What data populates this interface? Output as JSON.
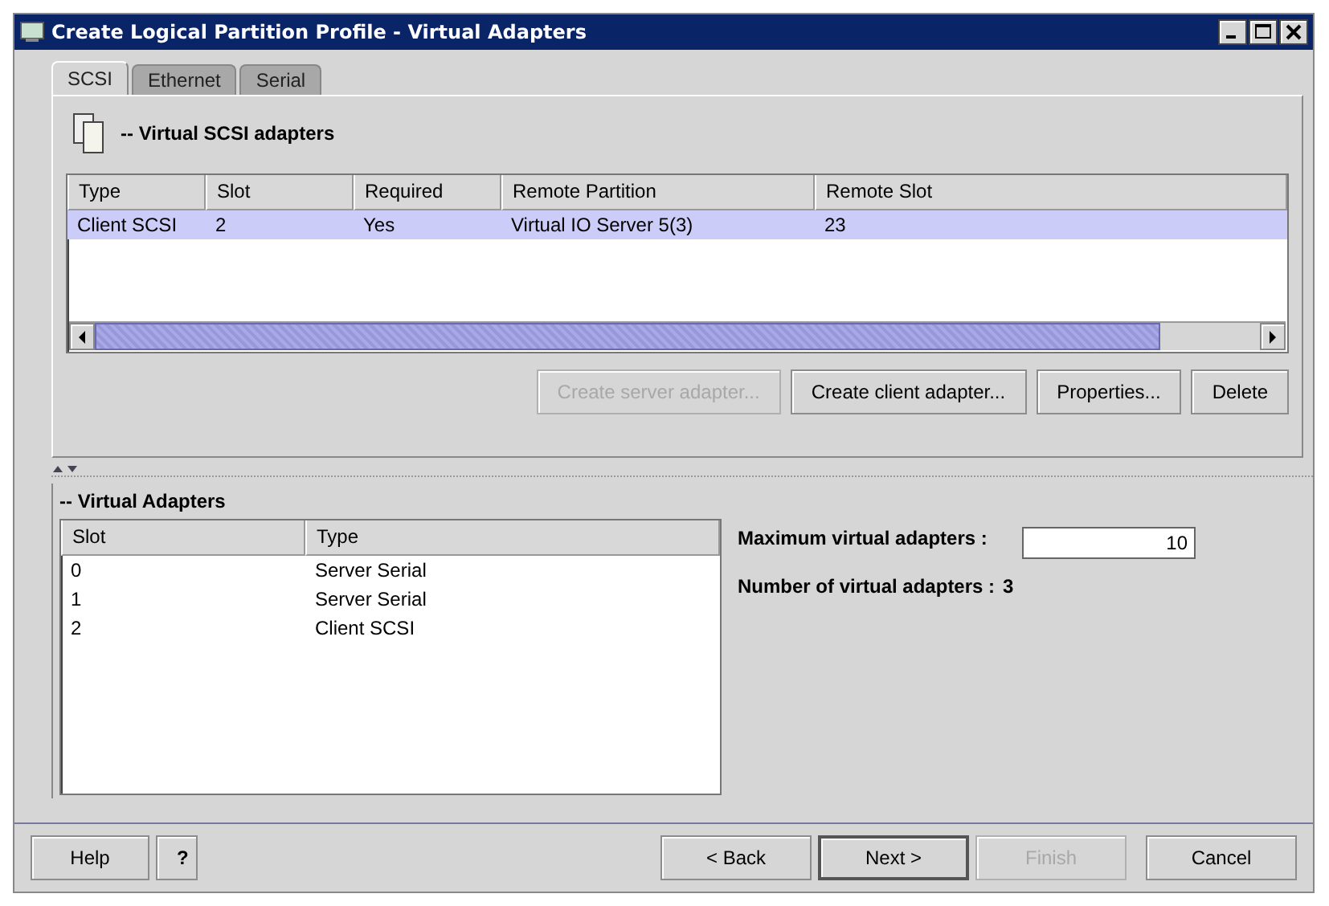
{
  "window": {
    "title": "Create Logical Partition Profile - Virtual Adapters"
  },
  "tabs": [
    {
      "label": "SCSI",
      "selected": true
    },
    {
      "label": "Ethernet",
      "selected": false
    },
    {
      "label": "Serial",
      "selected": false
    }
  ],
  "scsi_section": {
    "heading": "-- Virtual SCSI adapters",
    "table": {
      "columns": [
        "Type",
        "Slot",
        "Required",
        "Remote Partition",
        "Remote Slot"
      ],
      "rows": [
        {
          "cells": [
            "Client SCSI",
            "2",
            "Yes",
            "Virtual IO Server 5(3)",
            "23"
          ],
          "selected": true
        }
      ]
    },
    "buttons": [
      {
        "label": "Create server adapter...",
        "disabled": true
      },
      {
        "label": "Create client adapter...",
        "disabled": false
      },
      {
        "label": "Properties...",
        "disabled": false
      },
      {
        "label": "Delete",
        "disabled": false
      }
    ]
  },
  "adapters_section": {
    "heading": "-- Virtual Adapters",
    "table": {
      "columns": [
        "Slot",
        "Type"
      ],
      "rows": [
        {
          "cells": [
            "0",
            "Server Serial"
          ],
          "selected": false
        },
        {
          "cells": [
            "1",
            "Server Serial"
          ],
          "selected": false
        },
        {
          "cells": [
            "2",
            "Client SCSI"
          ],
          "selected": false
        }
      ]
    },
    "max_label": "Maximum virtual adapters :",
    "max_value": "10",
    "count_label": "Number of virtual adapters :",
    "count_value": "3"
  },
  "footer": {
    "left": [
      {
        "label": "Help",
        "disabled": false,
        "default": false
      },
      {
        "label": "?",
        "disabled": false,
        "default": false
      }
    ],
    "right": [
      {
        "label": "< Back",
        "disabled": false,
        "default": false
      },
      {
        "label": "Next >",
        "disabled": false,
        "default": true
      },
      {
        "label": "Finish",
        "disabled": true,
        "default": false
      },
      {
        "label": "Cancel",
        "disabled": false,
        "default": false
      }
    ]
  }
}
